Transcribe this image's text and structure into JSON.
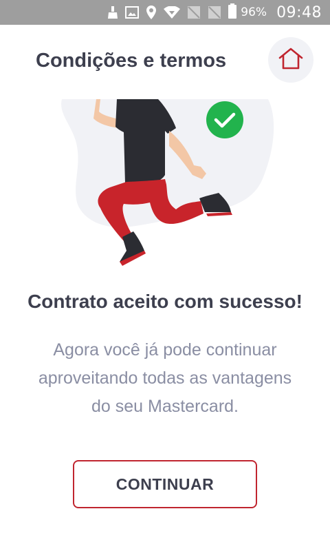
{
  "status_bar": {
    "battery_percent": "96%",
    "time": "09:48",
    "icons": [
      "cleaner-icon",
      "image-icon",
      "location-icon",
      "wifi-icon",
      "no-sim-icon",
      "no-sim-icon",
      "battery-icon"
    ]
  },
  "header": {
    "title": "Condições e termos",
    "home_icon": "home-icon"
  },
  "illustration": {
    "badge_icon": "check-circle-icon"
  },
  "content": {
    "title": "Contrato aceito com sucesso!",
    "description": "Agora você já pode continuar aproveitando todas as vantagens do seu Mastercard."
  },
  "actions": {
    "continue_label": "CONTINUAR"
  },
  "colors": {
    "accent": "#c0252f",
    "success": "#22b34d",
    "title_text": "#3d3f4e",
    "body_text": "#8a8ea3",
    "status_bar": "#9e9e9e"
  }
}
